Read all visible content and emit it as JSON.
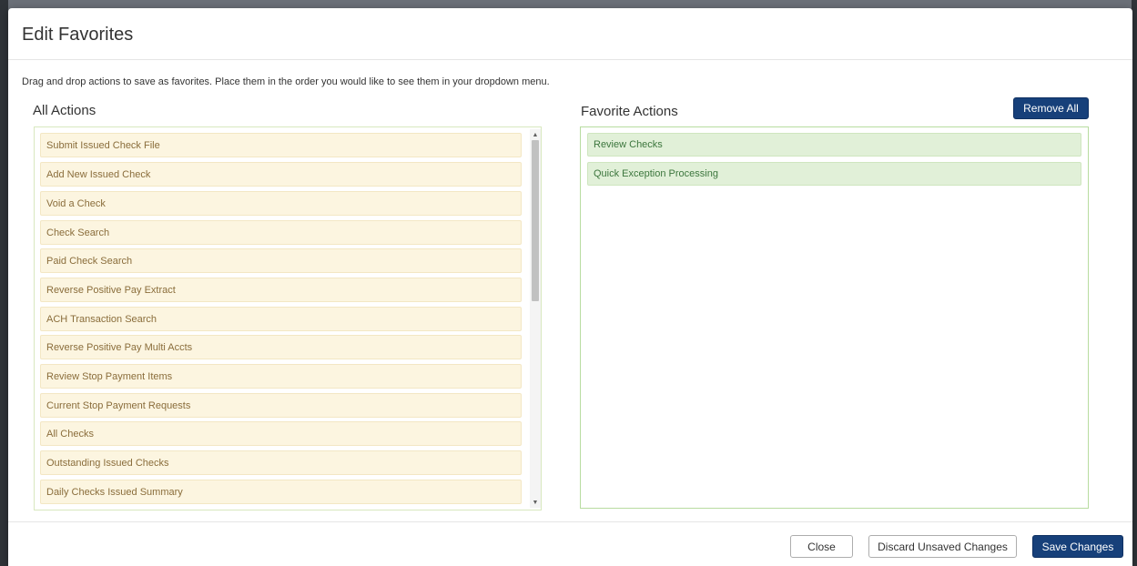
{
  "modal": {
    "title": "Edit Favorites",
    "instructions": "Drag and drop actions to save as favorites. Place them in the order you would like to see them in your dropdown menu."
  },
  "all_actions": {
    "title": "All Actions",
    "items": [
      "Submit Issued Check File",
      "Add New Issued Check",
      "Void a Check",
      "Check Search",
      "Paid Check Search",
      "Reverse Positive Pay Extract",
      "ACH Transaction Search",
      "Reverse Positive Pay Multi Accts",
      "Review Stop Payment Items",
      "Current Stop Payment Requests",
      "All Checks",
      "Outstanding Issued Checks",
      "Daily Checks Issued Summary"
    ]
  },
  "favorite_actions": {
    "title": "Favorite Actions",
    "remove_all_label": "Remove All",
    "items": [
      "Review Checks",
      "Quick Exception Processing"
    ]
  },
  "footer": {
    "close_label": "Close",
    "discard_label": "Discard Unsaved Changes",
    "save_label": "Save Changes"
  },
  "colors": {
    "primary_button": "#17407a",
    "all_item_bg": "#fcf5e0",
    "all_item_text": "#8a6d3b",
    "fav_item_bg": "#e1f0d8",
    "fav_item_text": "#3c763d"
  }
}
